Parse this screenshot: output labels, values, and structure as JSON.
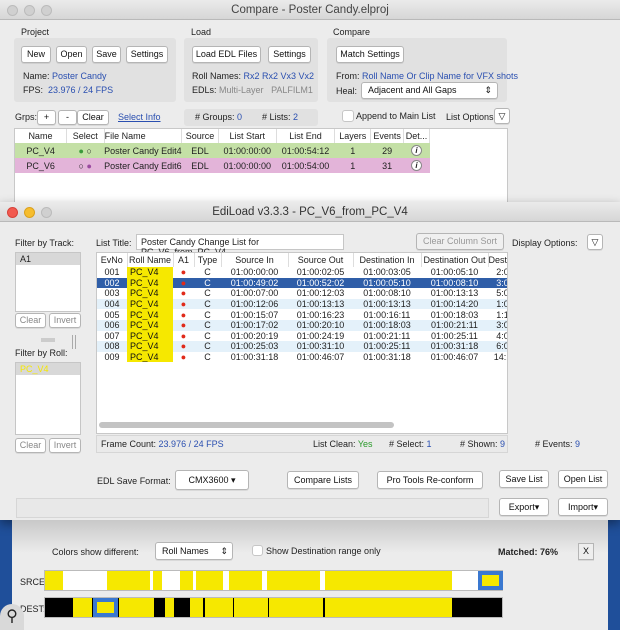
{
  "compare_window": {
    "title": "Compare - Poster Candy.elproj",
    "project": {
      "label": "Project",
      "buttons": [
        "New",
        "Open",
        "Save",
        "Settings"
      ],
      "name_label": "Name:",
      "name": "Poster Candy",
      "fps_label": "FPS:",
      "fps": "23.976 / 24 FPS"
    },
    "load": {
      "label": "Load",
      "buttons": [
        "Load EDL Files",
        "Settings"
      ],
      "roll_names_label": "Roll Names:",
      "roll_names": "Rx2 Rx2 Vx3 Vx2",
      "edls_label": "EDLs:",
      "edl_types": [
        "Multi-Layer",
        "PALFILM1"
      ]
    },
    "compare": {
      "label": "Compare",
      "button": "Match Settings",
      "from_label": "From:",
      "from": "Roll Name Or Clip Name for VFX shots",
      "heal_label": "Heal:",
      "heal": "Adjacent and All Gaps"
    },
    "grps_label": "Grps:",
    "plus": "+",
    "minus": "-",
    "clear": "Clear",
    "select_info": "Select Info",
    "groups_label": "# Groups:",
    "groups": "0",
    "lists_label": "# Lists:",
    "lists": "2",
    "append_label": "Append to Main List",
    "list_options_label": "List Options:",
    "columns": [
      "Name",
      "Select",
      "File Name",
      "Source",
      "List Start",
      "List End",
      "Layers",
      "Events",
      "Det..."
    ],
    "rows": [
      {
        "name": "PC_V4",
        "file": "Poster Candy Edit4",
        "source": "EDL",
        "start": "01:00:00:00",
        "end": "01:00:54:12",
        "layers": "1",
        "events": "29",
        "color": "#c4e0a6"
      },
      {
        "name": "PC_V6",
        "file": "Poster Candy Edit6",
        "source": "EDL",
        "start": "01:00:00:00",
        "end": "01:00:54:00",
        "layers": "1",
        "events": "31",
        "color": "#e3b4d9"
      }
    ]
  },
  "ediload": {
    "title": "EdiLoad v3.3.3  -  PC_V6_from_PC_V4",
    "filter_track_label": "Filter by Track:",
    "tracks": [
      "A1"
    ],
    "filter_roll_label": "Filter by Roll:",
    "rolls": [
      "PC_V4"
    ],
    "clear": "Clear",
    "invert": "Invert",
    "list_title_label": "List Title:",
    "list_title": "Poster Candy Change List for PC_V6_from_PC_V4",
    "clear_sort": "Clear Column Sort",
    "display_options_label": "Display Options:",
    "columns": [
      "EvNo",
      "Roll Name",
      "A1",
      "Type",
      "Source In",
      "Source Out",
      "Destination In",
      "Destination Out",
      "Dest Dur"
    ],
    "selected_row": 1,
    "events": [
      [
        "001",
        "PC_V4",
        "C",
        "01:00:00:00",
        "01:00:02:05",
        "01:00:03:05",
        "01:00:05:10",
        "2:0"
      ],
      [
        "002",
        "PC_V4",
        "C",
        "01:00:49:02",
        "01:00:52:02",
        "01:00:05:10",
        "01:00:08:10",
        "3:0"
      ],
      [
        "003",
        "PC_V4",
        "C",
        "01:00:07:00",
        "01:00:12:03",
        "01:00:08:10",
        "01:00:13:13",
        "5:0"
      ],
      [
        "004",
        "PC_V4",
        "C",
        "01:00:12:06",
        "01:00:13:13",
        "01:00:13:13",
        "01:00:14:20",
        "1:0"
      ],
      [
        "005",
        "PC_V4",
        "C",
        "01:00:15:07",
        "01:00:16:23",
        "01:00:16:11",
        "01:00:18:03",
        "1:1"
      ],
      [
        "006",
        "PC_V4",
        "C",
        "01:00:17:02",
        "01:00:20:10",
        "01:00:18:03",
        "01:00:21:11",
        "3:0"
      ],
      [
        "007",
        "PC_V4",
        "C",
        "01:00:20:19",
        "01:00:24:19",
        "01:00:21:11",
        "01:00:25:11",
        "4:0"
      ],
      [
        "008",
        "PC_V4",
        "C",
        "01:00:25:03",
        "01:00:31:10",
        "01:00:25:11",
        "01:00:31:18",
        "6:0"
      ],
      [
        "009",
        "PC_V4",
        "C",
        "01:00:31:18",
        "01:00:46:07",
        "01:00:31:18",
        "01:00:46:07",
        "14:1"
      ]
    ],
    "frame_count_label": "Frame Count:",
    "frame_count": "23.976 / 24 FPS",
    "list_clean_label": "List Clean:",
    "list_clean": "Yes",
    "select_label": "# Select:",
    "select": "1",
    "shown_label": "# Shown:",
    "shown": "9",
    "events_label": "# Events:",
    "events_count": "9",
    "edl_format_label": "EDL Save Format:",
    "edl_format": "CMX3600",
    "compare_lists": "Compare Lists",
    "pro_tools": "Pro Tools Re-conform",
    "save_list": "Save List",
    "open_list": "Open List",
    "export": "Export",
    "import": "Import"
  },
  "timeline": {
    "colors_label": "Colors show different:",
    "colors_value": "Roll Names",
    "show_dest_label": "Show Destination range only",
    "matched_label": "Matched:",
    "matched": "76%",
    "close": "X",
    "srce_label": "SRCE:",
    "dest_label": "DEST:",
    "colors": {
      "match": "#f6e800",
      "gap": "#ffffff",
      "black": "#000000",
      "selected": "#3a78d0"
    }
  }
}
